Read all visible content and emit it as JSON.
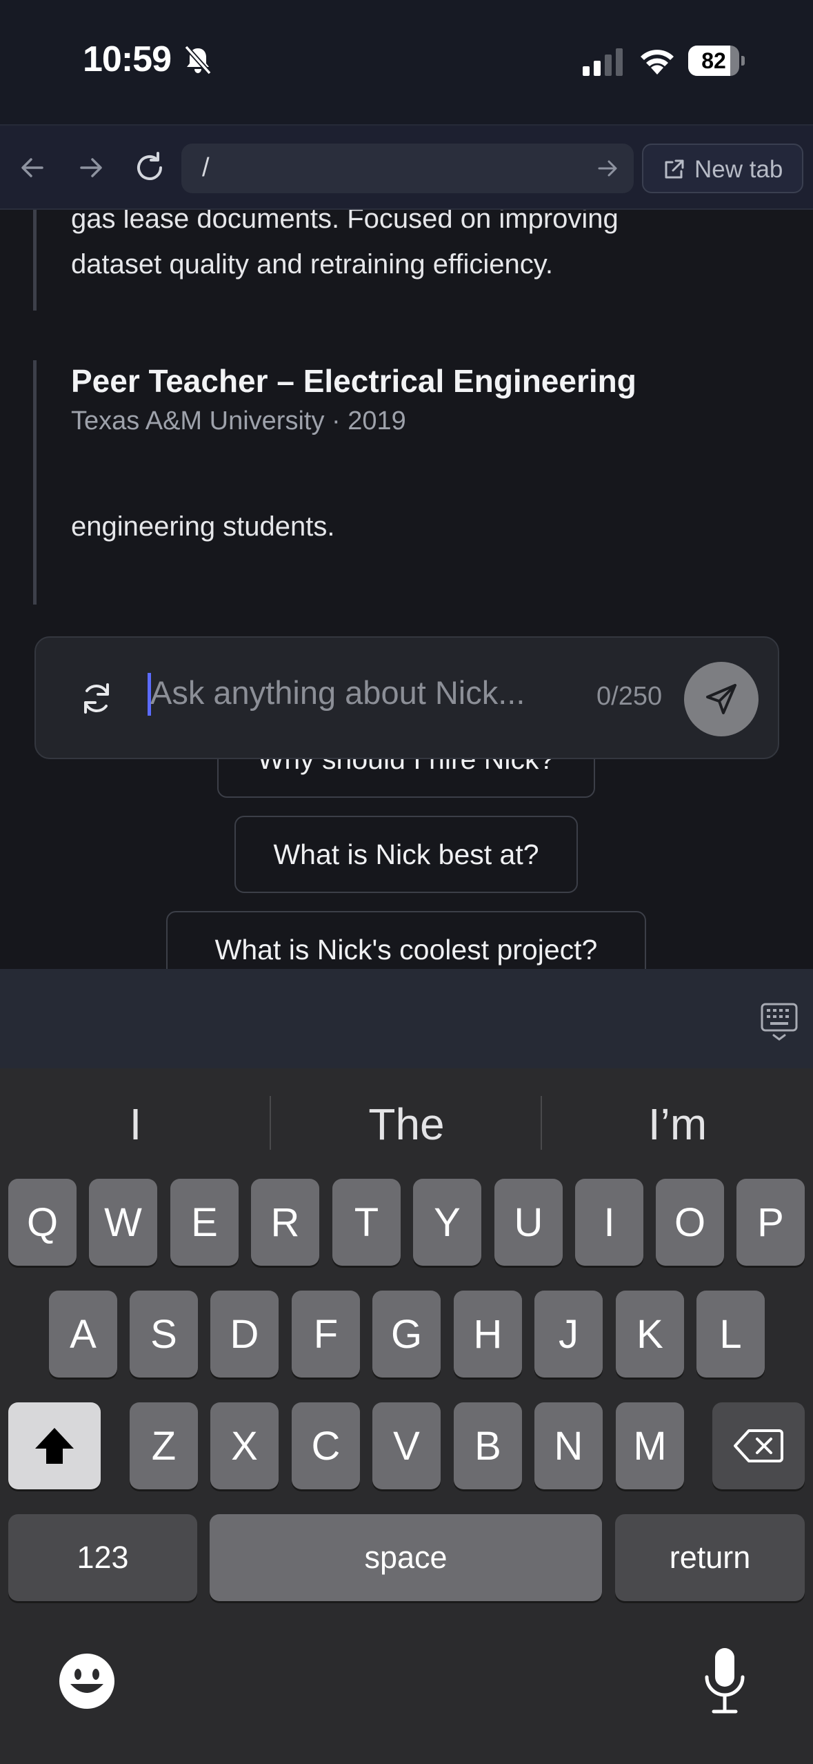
{
  "status_bar": {
    "time": "10:59",
    "battery_level": "82",
    "battery_fraction": 0.82,
    "icons": [
      "bell-slash-icon",
      "cellular-signal-icon",
      "wifi-icon",
      "battery-icon"
    ]
  },
  "browser": {
    "back_icon": "arrow-left-icon",
    "forward_icon": "arrow-right-icon",
    "reload_icon": "reload-icon",
    "url": "/",
    "go_icon": "arrow-right-icon",
    "new_tab_label": "New tab",
    "new_tab_icon": "external-link-icon"
  },
  "content": {
    "experience_1": {
      "lines": [
        "gas lease documents. Focused on improving",
        "dataset quality and retraining efficiency."
      ]
    },
    "experience_2": {
      "title": "Peer Teacher – Electrical Engineering",
      "subtitle": "Texas A&M University · 2019",
      "last_line": "engineering students."
    },
    "suggestions": [
      "Why should I hire Nick?",
      "What is Nick best at?",
      "What is Nick's coolest project?"
    ]
  },
  "chat": {
    "placeholder": "Ask anything about Nick...",
    "count": "0/250",
    "refresh_icon": "refresh-icon",
    "send_icon": "send-icon"
  },
  "keyboard": {
    "dismiss_icon": "keyboard-dismiss-icon",
    "predictions": [
      "I",
      "The",
      "I’m"
    ],
    "row1": [
      "Q",
      "W",
      "E",
      "R",
      "T",
      "Y",
      "U",
      "I",
      "O",
      "P"
    ],
    "row2": [
      "A",
      "S",
      "D",
      "F",
      "G",
      "H",
      "J",
      "K",
      "L"
    ],
    "row3": [
      "Z",
      "X",
      "C",
      "V",
      "B",
      "N",
      "M"
    ],
    "numbers_label": "123",
    "space_label": "space",
    "return_label": "return",
    "shift_icon": "shift-icon",
    "delete_icon": "delete-icon",
    "emoji_icon": "emoji-icon",
    "mic_icon": "microphone-icon"
  },
  "colors": {
    "accent_caret": "#5b6bff",
    "background": "#16171c",
    "send_button": "#7d7e82"
  }
}
